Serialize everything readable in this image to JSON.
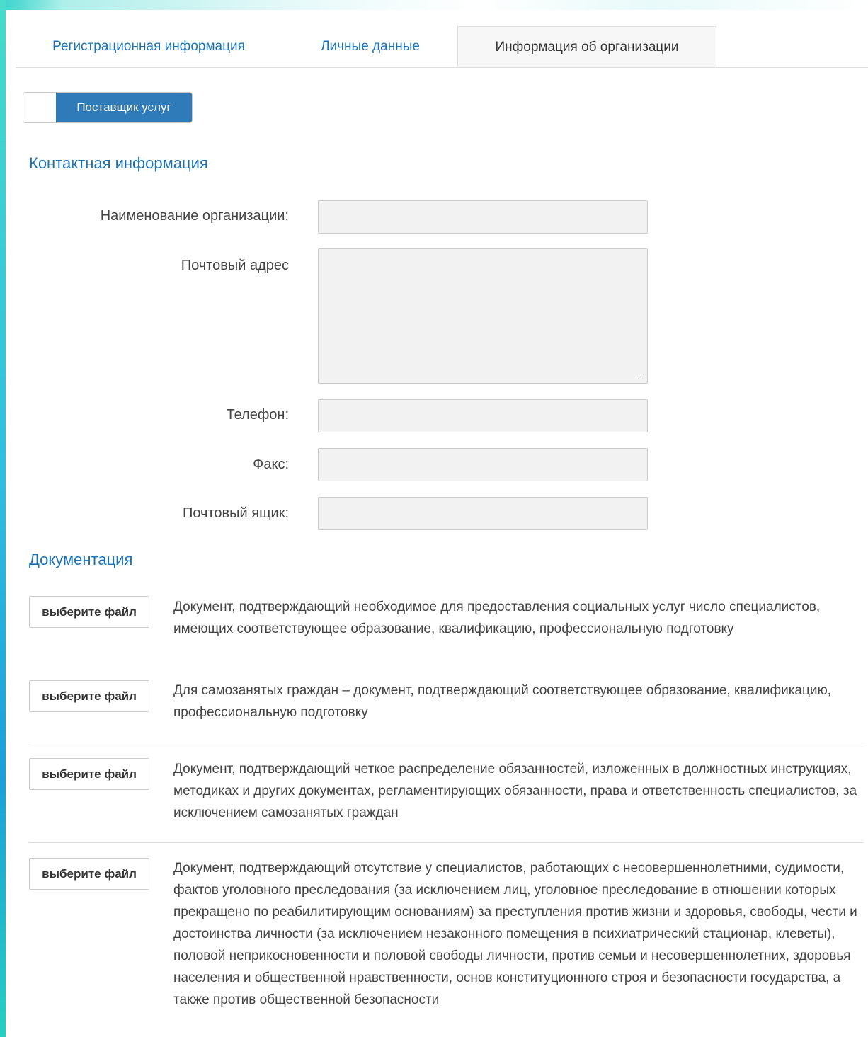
{
  "tabs": [
    {
      "label": "Регистрационная информация",
      "active": false
    },
    {
      "label": "Личные данные",
      "active": false
    },
    {
      "label": "Информация об организации",
      "active": true
    }
  ],
  "role_toggle": {
    "label": "Поставщик услуг",
    "on": true
  },
  "contact": {
    "title": "Контактная информация",
    "fields": {
      "org_name": {
        "label": "Наименование организации:",
        "value": ""
      },
      "postal_address": {
        "label": "Почтовый адрес",
        "value": ""
      },
      "phone": {
        "label": "Телефон:",
        "value": ""
      },
      "fax": {
        "label": "Факс:",
        "value": ""
      },
      "mailbox": {
        "label": "Почтовый ящик:",
        "value": ""
      }
    }
  },
  "docs": {
    "title": "Документация",
    "button_label": "выберите файл",
    "items": [
      {
        "text": "Документ, подтверждающий необходимое для предоставления социальных услуг число специалистов, имеющих соответствующее образование, квалификацию, профессиональную подготовку"
      },
      {
        "text": "Для самозанятых граждан – документ, подтверждающий соответствующее образование, квалификацию, профессиональную подготовку"
      },
      {
        "text": "Документ, подтверждающий четкое распределение обязанностей, изложенных в должностных инструкциях, методиках и других документах, регламентирующих обязанности, права и ответственность специалистов, за исключением самозанятых граждан"
      },
      {
        "text": "Документ, подтверждающий отсутствие у специалистов, работающих с несовершеннолетними, судимости, фактов уголовного преследования (за исключением лиц, уголовное преследование в отношении которых прекращено по реабилитирующим основаниям) за преступления против жизни и здоровья, свободы, чести и достоинства личности (за исключением незаконного помещения в психиатрический стационар, клеветы), половой неприкосновенности и половой свободы личности, против семьи и несовершеннолетних, здоровья населения и общественной нравственности, основ конституционного строя и безопасности государства, а также против общественной безопасности"
      }
    ]
  },
  "colors": {
    "link": "#1a73b8",
    "toggle_active": "#2f7ab8",
    "field_bg": "#f2f2f2",
    "accent_edge": "#24c7c3"
  }
}
